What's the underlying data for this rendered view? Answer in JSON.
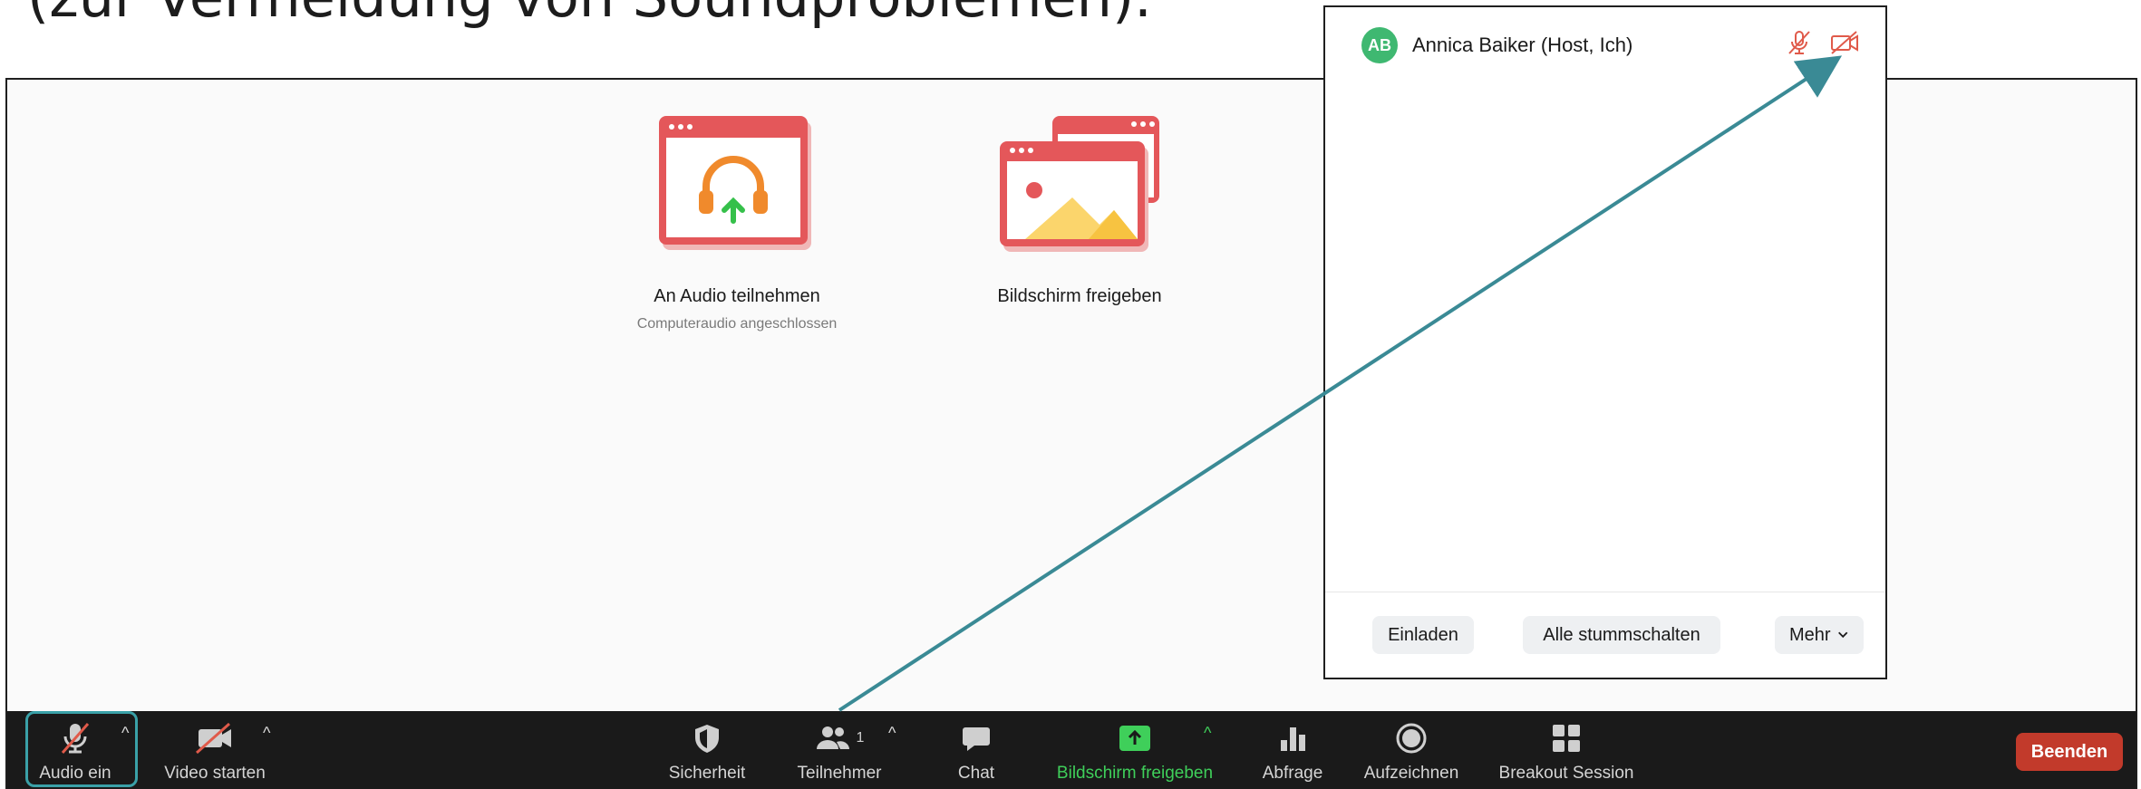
{
  "caption": "(zur Vermeidung von Soundproblemen).",
  "meeting": {
    "join_audio": {
      "label": "An Audio teilnehmen",
      "sublabel": "Computeraudio angeschlossen"
    },
    "share_screen": {
      "label": "Bildschirm freigeben"
    }
  },
  "toolbar": {
    "audio_label": "Audio ein",
    "video_label": "Video starten",
    "security_label": "Sicherheit",
    "participants_label": "Teilnehmer",
    "participants_count": "1",
    "chat_label": "Chat",
    "share_label": "Bildschirm freigeben",
    "poll_label": "Abfrage",
    "record_label": "Aufzeichnen",
    "breakout_label": "Breakout Session",
    "end_label": "Beenden"
  },
  "panel": {
    "participant": {
      "initials": "AB",
      "name": "Annica Baiker (Host, Ich)"
    },
    "invite_label": "Einladen",
    "mute_all_label": "Alle stummschalten",
    "more_label": "Mehr"
  },
  "colors": {
    "accent_teal": "#3a8a95",
    "share_green": "#3fcf5a",
    "muted_red": "#e05a4a",
    "end_red": "#c23a2b",
    "avatar_green": "#3fb871"
  },
  "icons": [
    "microphone-muted-icon",
    "video-off-icon",
    "shield-icon",
    "participants-icon",
    "chat-icon",
    "share-screen-icon",
    "poll-icon",
    "record-icon",
    "breakout-icon",
    "headphones-icon",
    "picture-icon",
    "chevron-down-icon"
  ]
}
